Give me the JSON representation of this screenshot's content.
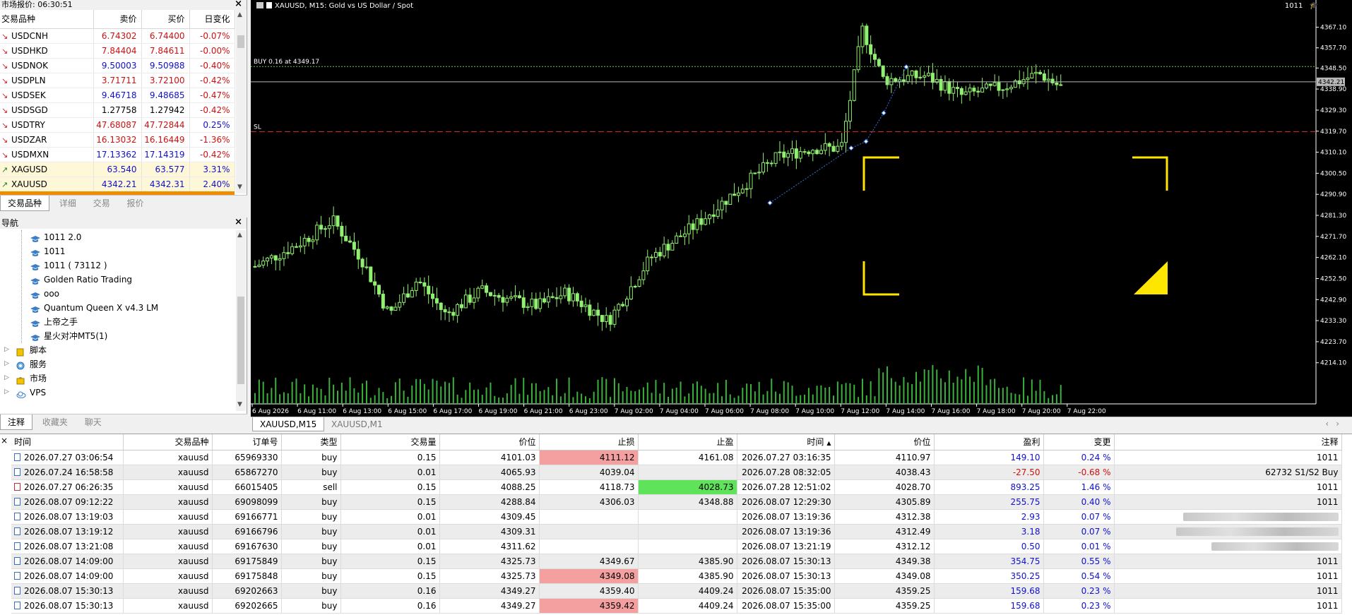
{
  "market_watch": {
    "title": "市场报价: 06:30:51",
    "columns": [
      "交易品种",
      "卖价",
      "买价",
      "日变化"
    ],
    "rows": [
      {
        "symbol": "USDCNH",
        "bid": "6.74302",
        "ask": "6.74400",
        "change": "-0.07%",
        "dir": "down",
        "color": "red",
        "hl": false
      },
      {
        "symbol": "USDHKD",
        "bid": "7.84404",
        "ask": "7.84611",
        "change": "-0.00%",
        "dir": "down",
        "color": "red",
        "hl": false
      },
      {
        "symbol": "USDNOK",
        "bid": "9.50003",
        "ask": "9.50988",
        "change": "-0.40%",
        "dir": "down",
        "color": "blue",
        "hl": false
      },
      {
        "symbol": "USDPLN",
        "bid": "3.71711",
        "ask": "3.72100",
        "change": "-0.42%",
        "dir": "down",
        "color": "red",
        "hl": false
      },
      {
        "symbol": "USDSEK",
        "bid": "9.46718",
        "ask": "9.48685",
        "change": "-0.47%",
        "dir": "down",
        "color": "blue",
        "hl": false
      },
      {
        "symbol": "USDSGD",
        "bid": "1.27758",
        "ask": "1.27942",
        "change": "-0.42%",
        "dir": "down",
        "color": "black",
        "hl": false
      },
      {
        "symbol": "USDTRY",
        "bid": "47.68087",
        "ask": "47.72844",
        "change": "0.25%",
        "dir": "down",
        "color": "red",
        "hl": false
      },
      {
        "symbol": "USDZAR",
        "bid": "16.13032",
        "ask": "16.16449",
        "change": "-1.36%",
        "dir": "down",
        "color": "red",
        "hl": false
      },
      {
        "symbol": "USDMXN",
        "bid": "17.13362",
        "ask": "17.14319",
        "change": "-0.42%",
        "dir": "down",
        "color": "blue",
        "hl": false
      },
      {
        "symbol": "XAGUSD",
        "bid": "63.540",
        "ask": "63.577",
        "change": "3.31%",
        "dir": "up",
        "color": "blue",
        "hl": true
      },
      {
        "symbol": "XAUUSD",
        "bid": "4342.21",
        "ask": "4342.31",
        "change": "2.40%",
        "dir": "up",
        "color": "blue",
        "hl": true
      }
    ],
    "tabs": [
      "交易品种",
      "详细",
      "交易",
      "报价"
    ]
  },
  "navigator": {
    "title": "导航",
    "experts": [
      "1011 2.0",
      "1011",
      "1011 ( 73112 )",
      "Golden Ratio Trading",
      "ooo",
      "Quantum Queen X v4.3 LM",
      "上帝之手",
      "星火对冲MT5(1)"
    ],
    "folders": [
      "脚本",
      "服务",
      "市场",
      "VPS"
    ],
    "tabs": [
      "注释",
      "收藏夹",
      "聊天"
    ]
  },
  "chart": {
    "header": "XAUUSD, M15:  Gold vs US Dollar / Spot",
    "account": "1011",
    "buy_label": "BUY 0.16 at 4349.17",
    "sl_label": "SL",
    "current_price": "4342.21",
    "buy_price": 4349.17,
    "sl_price": 4319.5,
    "ylim": [
      4205,
      4375
    ],
    "y_ticks": [
      "4367.10",
      "4357.70",
      "4348.50",
      "4338.90",
      "4329.30",
      "4319.70",
      "4310.10",
      "4300.50",
      "4290.90",
      "4281.30",
      "4271.70",
      "4262.10",
      "4252.50",
      "4242.90",
      "4233.30",
      "4223.70",
      "4214.10"
    ],
    "x_ticks": [
      "6 Aug 2026",
      "6 Aug 11:00",
      "6 Aug 13:00",
      "6 Aug 15:00",
      "6 Aug 17:00",
      "6 Aug 19:00",
      "6 Aug 21:00",
      "6 Aug 23:00",
      "7 Aug 02:00",
      "7 Aug 04:00",
      "7 Aug 06:00",
      "7 Aug 08:00",
      "7 Aug 10:00",
      "7 Aug 12:00",
      "7 Aug 14:00",
      "7 Aug 16:00",
      "7 Aug 18:00",
      "7 Aug 20:00",
      "7 Aug 22:00"
    ],
    "colors": {
      "candle": "#90f070",
      "buy_line": "#6fbf4a",
      "sl_line": "#e03030",
      "volume": "#3cb03c",
      "marker": "#ffe600",
      "grid_text": "#ffffff"
    },
    "tabs": [
      "XAUUSD,M15",
      "XAUUSD,M1"
    ]
  },
  "history": {
    "columns": [
      "时间",
      "交易品种",
      "订单号",
      "类型",
      "交易量",
      "价位",
      "止损",
      "止盈",
      "时间",
      "价位",
      "盈利",
      "变更",
      "注释"
    ],
    "rows": [
      {
        "open_time": "2026.07.27 03:06:54",
        "symbol": "xauusd",
        "ticket": "65969330",
        "type": "buy",
        "volume": "0.15",
        "open_price": "4101.03",
        "sl": "4111.12",
        "tp": "4161.08",
        "close_time": "2026.07.27 03:16:35",
        "close_price": "4110.97",
        "profit": "149.10",
        "change": "0.24 %",
        "comment": "1011",
        "sl_hit": true,
        "tp_hit": false,
        "neg": false,
        "blur": false
      },
      {
        "open_time": "2026.07.24 16:58:58",
        "symbol": "xauusd",
        "ticket": "65867270",
        "type": "buy",
        "volume": "0.01",
        "open_price": "4065.93",
        "sl": "4039.04",
        "tp": "",
        "close_time": "2026.07.28 08:32:05",
        "close_price": "4038.43",
        "profit": "-27.50",
        "change": "-0.68 %",
        "comment": "62732 S1/S2 Buy",
        "sl_hit": true,
        "tp_hit": false,
        "neg": true,
        "blur": false
      },
      {
        "open_time": "2026.07.27 06:26:35",
        "symbol": "xauusd",
        "ticket": "66015405",
        "type": "sell",
        "volume": "0.15",
        "open_price": "4088.25",
        "sl": "4118.73",
        "tp": "4028.73",
        "close_time": "2026.07.28 12:51:02",
        "close_price": "4028.70",
        "profit": "893.25",
        "change": "1.46 %",
        "comment": "1011",
        "sl_hit": false,
        "tp_hit": true,
        "neg": false,
        "blur": false,
        "red_icon": true
      },
      {
        "open_time": "2026.08.07 09:12:22",
        "symbol": "xauusd",
        "ticket": "69098099",
        "type": "buy",
        "volume": "0.15",
        "open_price": "4288.84",
        "sl": "4306.03",
        "tp": "4348.88",
        "close_time": "2026.08.07 12:29:30",
        "close_price": "4305.89",
        "profit": "255.75",
        "change": "0.40 %",
        "comment": "1011",
        "sl_hit": true,
        "tp_hit": false,
        "neg": false,
        "blur": false
      },
      {
        "open_time": "2026.08.07 13:19:03",
        "symbol": "xauusd",
        "ticket": "69166771",
        "type": "buy",
        "volume": "0.01",
        "open_price": "4309.45",
        "sl": "",
        "tp": "",
        "close_time": "2026.08.07 13:19:36",
        "close_price": "4312.38",
        "profit": "2.93",
        "change": "0.07 %",
        "comment": "",
        "sl_hit": false,
        "tp_hit": false,
        "neg": false,
        "blur": true
      },
      {
        "open_time": "2026.08.07 13:19:12",
        "symbol": "xauusd",
        "ticket": "69166796",
        "type": "buy",
        "volume": "0.01",
        "open_price": "4309.31",
        "sl": "",
        "tp": "",
        "close_time": "2026.08.07 13:19:36",
        "close_price": "4312.49",
        "profit": "3.18",
        "change": "0.07 %",
        "comment": "",
        "sl_hit": false,
        "tp_hit": false,
        "neg": false,
        "blur": true
      },
      {
        "open_time": "2026.08.07 13:21:08",
        "symbol": "xauusd",
        "ticket": "69167630",
        "type": "buy",
        "volume": "0.01",
        "open_price": "4311.62",
        "sl": "",
        "tp": "",
        "close_time": "2026.08.07 13:21:19",
        "close_price": "4312.12",
        "profit": "0.50",
        "change": "0.01 %",
        "comment": "",
        "sl_hit": false,
        "tp_hit": false,
        "neg": false,
        "blur": true
      },
      {
        "open_time": "2026.08.07 14:09:00",
        "symbol": "xauusd",
        "ticket": "69175849",
        "type": "buy",
        "volume": "0.15",
        "open_price": "4325.73",
        "sl": "4349.67",
        "tp": "4385.90",
        "close_time": "2026.08.07 15:30:13",
        "close_price": "4349.38",
        "profit": "354.75",
        "change": "0.55 %",
        "comment": "1011",
        "sl_hit": true,
        "tp_hit": false,
        "neg": false,
        "blur": false
      },
      {
        "open_time": "2026.08.07 14:09:00",
        "symbol": "xauusd",
        "ticket": "69175848",
        "type": "buy",
        "volume": "0.15",
        "open_price": "4325.73",
        "sl": "4349.08",
        "tp": "4385.90",
        "close_time": "2026.08.07 15:30:13",
        "close_price": "4349.08",
        "profit": "350.25",
        "change": "0.54 %",
        "comment": "1011",
        "sl_hit": true,
        "tp_hit": false,
        "neg": false,
        "blur": false
      },
      {
        "open_time": "2026.08.07 15:30:13",
        "symbol": "xauusd",
        "ticket": "69202663",
        "type": "buy",
        "volume": "0.16",
        "open_price": "4349.27",
        "sl": "4359.40",
        "tp": "4409.24",
        "close_time": "2026.08.07 15:35:00",
        "close_price": "4359.25",
        "profit": "159.68",
        "change": "0.23 %",
        "comment": "1011",
        "sl_hit": true,
        "tp_hit": false,
        "neg": false,
        "blur": false
      },
      {
        "open_time": "2026.08.07 15:30:13",
        "symbol": "xauusd",
        "ticket": "69202665",
        "type": "buy",
        "volume": "0.16",
        "open_price": "4349.27",
        "sl": "4359.42",
        "tp": "4409.24",
        "close_time": "2026.08.07 15:35:00",
        "close_price": "4359.25",
        "profit": "159.68",
        "change": "0.23 %",
        "comment": "1011",
        "sl_hit": true,
        "tp_hit": false,
        "neg": false,
        "blur": false
      }
    ]
  }
}
